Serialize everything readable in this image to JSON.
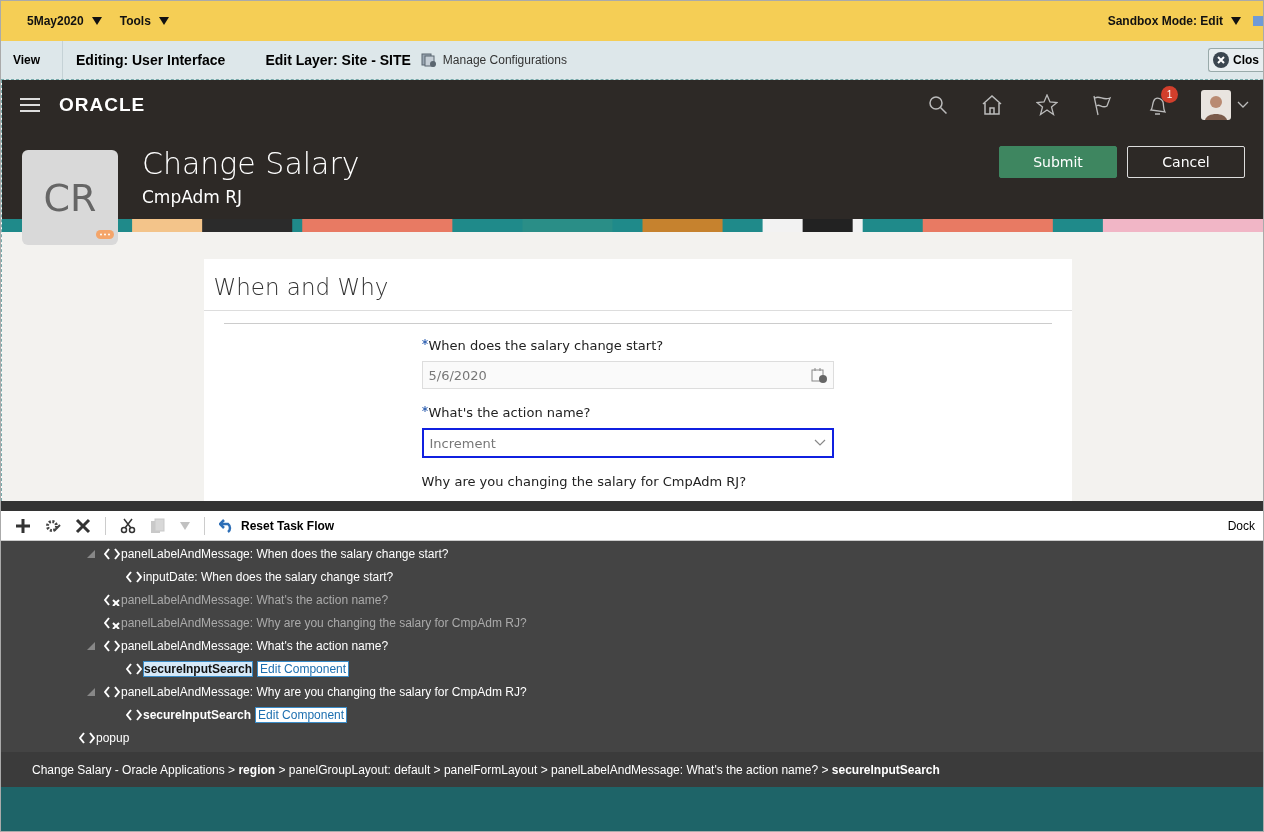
{
  "top_bar": {
    "menus": [
      "5May2020",
      "Tools"
    ],
    "sandbox": "Sandbox Mode: Edit"
  },
  "edit_bar": {
    "view": "View",
    "editing": "Editing: User Interface",
    "layer": "Edit Layer: Site - SITE",
    "manage": "Manage Configurations",
    "close": "Clos"
  },
  "header": {
    "logo": "ORACLE",
    "notification_count": "1",
    "title": "Change Salary",
    "subtitle": "CmpAdm RJ",
    "initials": "CR",
    "buttons": [
      {
        "label": "Submit",
        "kind": "primary"
      },
      {
        "label": "Cancel",
        "kind": "secondary"
      }
    ]
  },
  "section": {
    "title": "When and Why",
    "fields": [
      {
        "label": "When does the salary change start?",
        "required": true,
        "kind": "date",
        "value": "5/6/2020",
        "focused": false
      },
      {
        "label": "What's the action name?",
        "required": true,
        "kind": "select",
        "value": "Increment",
        "focused": true
      },
      {
        "label": "Why are you changing the salary for CmpAdm RJ?",
        "kind": "label"
      }
    ]
  },
  "toolbar": {
    "reset": "Reset Task Flow",
    "dock": "Dock",
    "copy_disabled": true
  },
  "tree": {
    "nested_nodes": [
      {
        "label": "panelLabelAndMessage: When does the salary change start?",
        "hidden": false,
        "expanded": true,
        "children": [
          {
            "label": "inputDate: When does the salary change start?",
            "selected": false
          }
        ]
      },
      {
        "label": "panelLabelAndMessage: What's the action name?",
        "hidden": true,
        "expanded": false
      },
      {
        "label": "panelLabelAndMessage: Why are you changing the salary for CmpAdm RJ?",
        "hidden": true,
        "expanded": false
      },
      {
        "label": "panelLabelAndMessage: What's the action name?",
        "hidden": false,
        "expanded": true,
        "children": [
          {
            "label": "secureInputSearch",
            "selected": true,
            "link": "Edit Component"
          }
        ]
      },
      {
        "label": "panelLabelAndMessage: Why are you changing the salary for CmpAdm RJ?",
        "hidden": false,
        "expanded": true,
        "children": [
          {
            "label": "secureInputSearch",
            "selected": false,
            "link": "Edit Component"
          }
        ]
      }
    ],
    "outer_nodes": [
      {
        "label": "popup"
      }
    ]
  },
  "breadcrumb": "Change Salary - Oracle Applications > **region** > panelGroupLayout: default > panelFormLayout > panelLabelAndMessage: What's the action name? > **secureInputSearch**"
}
